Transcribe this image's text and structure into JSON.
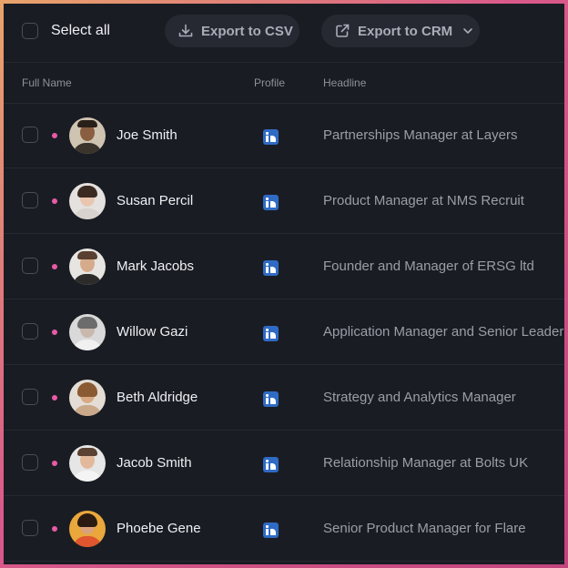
{
  "toolbar": {
    "select_all_label": "Select all",
    "export_csv_label": "Export to CSV",
    "export_crm_label": "Export to CRM"
  },
  "table": {
    "columns": [
      "Full Name",
      "Profile",
      "Headline"
    ],
    "rows": [
      {
        "name": "Joe Smith",
        "headline": "Partnerships Manager at Layers"
      },
      {
        "name": "Susan Percil",
        "headline": "Product Manager at NMS Recruit"
      },
      {
        "name": "Mark Jacobs",
        "headline": "Founder and Manager of ERSG ltd"
      },
      {
        "name": "Willow Gazi",
        "headline": "Application Manager and Senior Leader"
      },
      {
        "name": "Beth Aldridge",
        "headline": "Strategy and Analytics Manager"
      },
      {
        "name": "Jacob Smith",
        "headline": "Relationship Manager at Bolts UK"
      },
      {
        "name": "Phoebe Gene",
        "headline": "Senior Product Manager for Flare"
      }
    ]
  },
  "icons": {
    "profile_icon": "linkedin-icon",
    "export_csv_icon": "download-icon",
    "export_crm_icon": "external-link-icon"
  },
  "colors": {
    "background": "#1a1c23",
    "status_dot": "#e85aa6",
    "linkedin": "#2f6bc4"
  }
}
